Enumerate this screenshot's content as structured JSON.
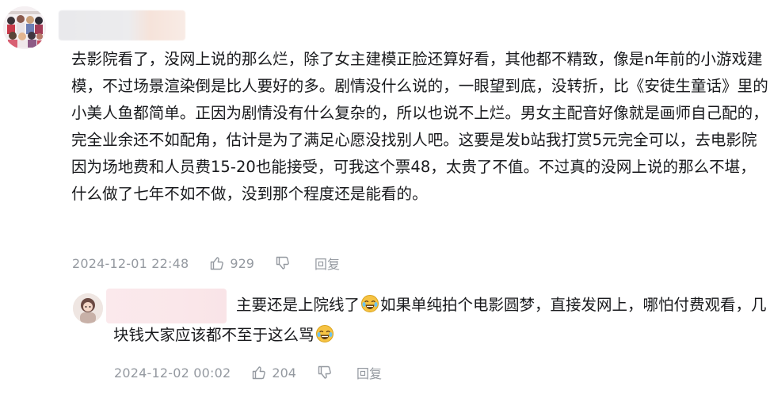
{
  "comment": {
    "text": "去影院看了，没网上说的那么烂，除了女主建模正脸还算好看，其他都不精致，像是n年前的小游戏建模，不过场景渲染倒是比人要好的多。剧情没什么说的，一眼望到底，没转折，比《安徒生童话》里的小美人鱼都简单。正因为剧情没有什么复杂的，所以也说不上烂。男女主配音好像就是画师自己配的，完全业余还不如配角，估计是为了满足心愿没找别人吧。这要是发b站我打赏5元完全可以，去电影院因为场地费和人员费15-20也能接受，可我这个票48，太贵了不值。不过真的没网上说的那么不堪，什么做了七年不如不做，没到那个程度还是能看的。",
    "timestamp": "2024-12-01 22:48",
    "like_count": "929",
    "reply_label": "回复"
  },
  "reply": {
    "text_part1": "主要还是上院线了",
    "emoji_1": "crying-laughing-emoji",
    "text_part2": "如果单纯拍个电影圆梦，直接发网上，哪怕付费观看，几块钱大家应该都不至于这么骂",
    "emoji_2": "crying-laughing-emoji",
    "timestamp": "2024-12-02 00:02",
    "like_count": "204",
    "reply_label": "回复"
  },
  "icons": {
    "like": "thumbs-up-icon",
    "dislike": "thumbs-down-icon"
  },
  "colors": {
    "text": "#18191c",
    "meta": "#9499a0",
    "emoji": "#f6c343"
  }
}
